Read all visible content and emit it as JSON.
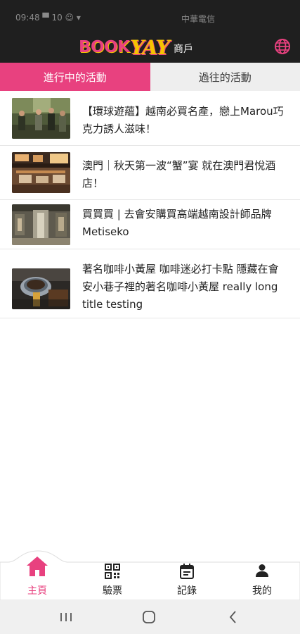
{
  "status_bar": {
    "time": "09:48 ▀ 10 ☺ ▾",
    "carrier": "中華電信"
  },
  "app_bar": {
    "logo_part1": "BOOK",
    "logo_part2": "YAY",
    "logo_sub": "商戶"
  },
  "tabs": [
    {
      "label": "進行中的活動",
      "active": true
    },
    {
      "label": "過往的活動",
      "active": false
    }
  ],
  "events": [
    {
      "title": "【環球遊蘊】越南必買名產，戀上Marou巧克力誘人滋味！",
      "image": "forest-people-photo"
    },
    {
      "title": "澳門｜秋天第一波“蟹”宴 就在澳門君悅酒店！",
      "image": "restaurant-interior-photo"
    },
    {
      "title": "買買買 | 去會安購買高端越南設計師品牌Metiseko",
      "image": "boutique-store-photo"
    },
    {
      "title": "著名咖啡小黃屋 咖啡迷必打卡點 隱藏在會安小巷子裡的著名咖啡小黃屋 really long title testing",
      "image": "coffee-cup-photo"
    }
  ],
  "bottom_nav": [
    {
      "label": "主頁",
      "icon": "home-icon",
      "active": true
    },
    {
      "label": "驗票",
      "icon": "qr-code-icon",
      "active": false
    },
    {
      "label": "記錄",
      "icon": "calendar-icon",
      "active": false
    },
    {
      "label": "我的",
      "icon": "person-icon",
      "active": false
    }
  ],
  "colors": {
    "accent": "#e8417f",
    "logo_yellow": "#f5c400",
    "app_bar": "#1f1f1f",
    "inactive_tab": "#eeeeee"
  }
}
